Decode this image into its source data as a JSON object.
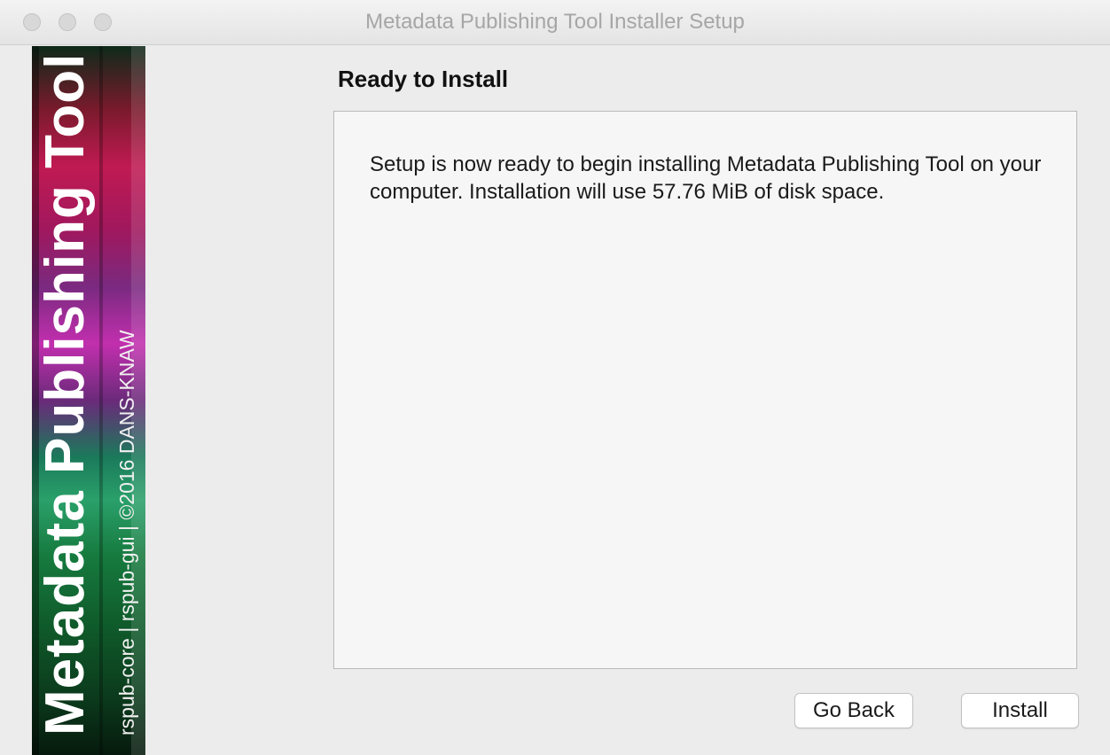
{
  "window": {
    "title": "Metadata Publishing Tool Installer Setup"
  },
  "banner": {
    "title": "Metadata Publishing Tool",
    "subtitle": "rspub-core | rspub-gui | ©2016 DANS-KNAW"
  },
  "page": {
    "heading": "Ready to Install",
    "message": "Setup is now ready to begin installing Metadata Publishing Tool on your computer. Installation will use 57.76 MiB of disk space."
  },
  "buttons": {
    "back_label": "Go Back",
    "install_label": "Install"
  }
}
